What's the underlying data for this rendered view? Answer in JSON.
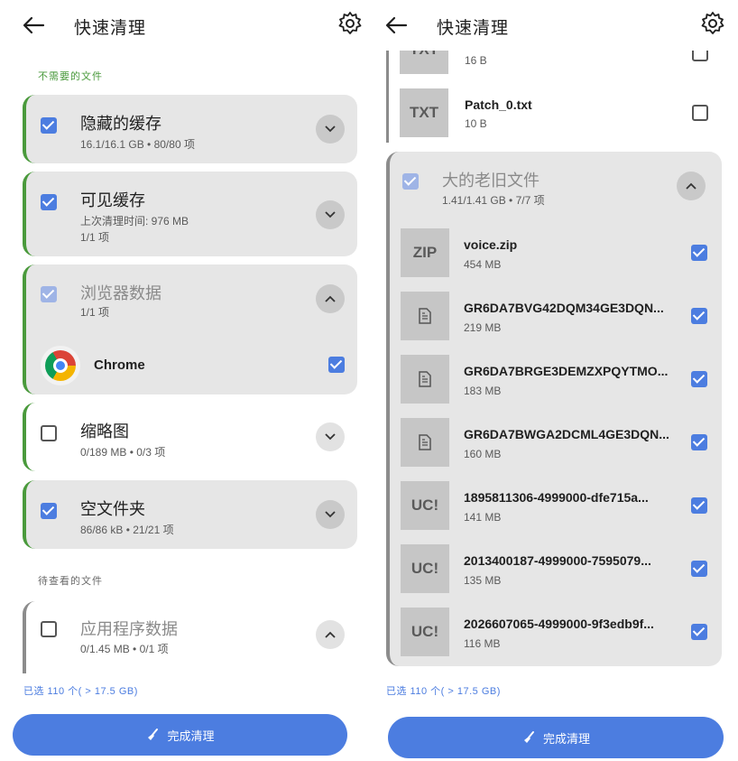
{
  "left": {
    "title": "快速清理",
    "section_unneeded": "不需要的文件",
    "section_review": "待查看的文件",
    "cards": [
      {
        "title": "隐藏的缓存",
        "sub1": "16.1/16.1 GB • 80/80 项"
      },
      {
        "title": "可见缓存",
        "sub1": "上次清理时间: 976 MB",
        "sub2": "1/1 项"
      },
      {
        "title": "浏览器数据",
        "sub1": "1/1 项",
        "child": "Chrome"
      },
      {
        "title": "缩略图",
        "sub1": "0/189 MB • 0/3 项"
      },
      {
        "title": "空文件夹",
        "sub1": "86/86 kB • 21/21 项"
      },
      {
        "title": "应用程序数据",
        "sub1": "0/1.45 MB • 0/1 项"
      }
    ],
    "selected": "已选 110 个( > 17.5 GB)",
    "button": "完成清理"
  },
  "right": {
    "title": "快速清理",
    "top_files": [
      {
        "thumb": "TXT",
        "name": "",
        "size": "16 B"
      },
      {
        "thumb": "TXT",
        "name": "Patch_0.txt",
        "size": "10 B"
      }
    ],
    "group": {
      "title": "大的老旧文件",
      "sub": "1.41/1.41 GB • 7/7 项"
    },
    "files": [
      {
        "thumb": "ZIP",
        "name": "voice.zip",
        "size": "454 MB"
      },
      {
        "thumb": "doc",
        "name": "GR6DA7BVG42DQM34GE3DQN...",
        "size": "219 MB"
      },
      {
        "thumb": "doc",
        "name": "GR6DA7BRGE3DEMZXPQYTMO...",
        "size": "183 MB"
      },
      {
        "thumb": "doc",
        "name": "GR6DA7BWGA2DCML4GE3DQN...",
        "size": "160 MB"
      },
      {
        "thumb": "UC!",
        "name": "1895811306-4999000-dfe715a...",
        "size": "141 MB"
      },
      {
        "thumb": "UC!",
        "name": "2013400187-4999000-7595079...",
        "size": "135 MB"
      },
      {
        "thumb": "UC!",
        "name": "2026607065-4999000-9f3edb9f...",
        "size": "116 MB"
      }
    ],
    "selected": "已选 110 个( > 17.5 GB)",
    "button": "完成清理"
  },
  "colors": {
    "accent": "#4c7de0",
    "green_bar": "#4a9a3c",
    "card_bg": "#e6e6e6"
  }
}
